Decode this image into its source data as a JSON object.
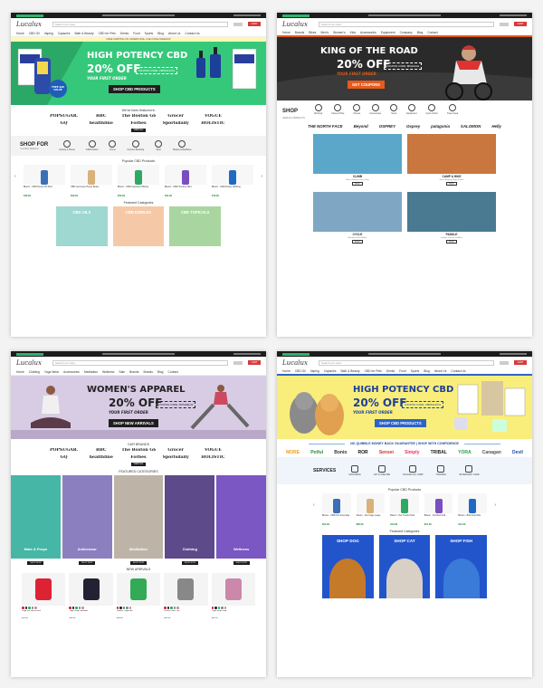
{
  "header": {
    "logo": "Lucalux",
    "search_placeholder": "Search our store",
    "cart_label": "CART",
    "promo": "FREE SHIPPING ON ORDERS $49+ USE CODE FREESHIP"
  },
  "s1": {
    "nav": [
      "Home",
      "CBD Oil",
      "Vaping",
      "Capsules",
      "Bath & Beauty",
      "CBD for Pets",
      "Drinks",
      "Food",
      "Sports",
      "Blog",
      "About Us",
      "Contact Us"
    ],
    "hero_title": "HIGH POTENCY CBD",
    "hero_off": "20% OFF",
    "hero_sub": "YOUR FIRST ORDER",
    "coupon": "COUPON CODE: CBDSCHOOL",
    "cta": "SHOP CBD PRODUCTS",
    "badge": "FREE $60 VALUE",
    "featured_title": "We've been featured in",
    "brands": [
      "POPSUGAR.",
      "BBC",
      "The Boston Globe",
      "Grocer",
      "VOGUE",
      "GQ",
      "healthline",
      "Forbes",
      "Sportsdaily",
      "HOLISTIC"
    ],
    "view_all": "VIEW ALL",
    "shop_for": "SHOP FOR",
    "shop_for_sub": "Your Best Wellness",
    "icons": [
      {
        "icon": "sleep-icon",
        "label": "Anxiety & Stress"
      },
      {
        "icon": "pain-icon",
        "label": "Inflammation"
      },
      {
        "icon": "focus-icon",
        "label": "Focus"
      },
      {
        "icon": "muscle-icon",
        "label": "Immune Boosting"
      },
      {
        "icon": "sport-icon",
        "label": "Sport"
      },
      {
        "icon": "beauty-icon",
        "label": "Beauty & Radiance"
      }
    ],
    "popular_title": "Popular CBD Products",
    "products": [
      {
        "title": "Bloom - CBD Hemp Oil 30ml",
        "price": "$49.99"
      },
      {
        "title": "CBD Gummies Hemp Bears",
        "price": "$29.99"
      },
      {
        "title": "Bloom - CBD Capsules 500mg",
        "price": "$59.99"
      },
      {
        "title": "Bloom - CBD Tincture Mint",
        "price": "$44.99"
      },
      {
        "title": "Bloom - CBD Drops 1000mg",
        "price": "$79.99"
      }
    ],
    "featured_categories": "Featured Categories",
    "cats": [
      {
        "name": "CBD OILS",
        "color": "#9fd7d1"
      },
      {
        "name": "CBD EDIBLES",
        "color": "#f5c9a8"
      },
      {
        "name": "CBD TOPICALS",
        "color": "#a9d6a0"
      }
    ]
  },
  "s2": {
    "nav": [
      "Home",
      "Brands",
      "Bikes",
      "Men's",
      "Women's",
      "Kids",
      "Accessories",
      "Equipment",
      "Company",
      "Blog",
      "Contact"
    ],
    "hero_title": "KING OF THE ROAD",
    "hero_off": "20% OFF",
    "hero_sub": "YOUR FIRST ORDER",
    "coupon": "COUPON CODE: BIKESALE",
    "cta": "GET COUPONS",
    "shop": "SHOP",
    "shop_sub": "VIEW ALL PRODUCTS",
    "icons": [
      {
        "icon": "climbing-icon",
        "label": "Climbing"
      },
      {
        "icon": "camp-icon",
        "label": "Camp & Hike"
      },
      {
        "icon": "fitness-icon",
        "label": "Fitness"
      },
      {
        "icon": "accessories-icon",
        "label": "Accessories"
      },
      {
        "icon": "snow-icon",
        "label": "Snow"
      },
      {
        "icon": "equipment-icon",
        "label": "Equipment"
      },
      {
        "icon": "cycle-icon",
        "label": "Cycle & Run"
      },
      {
        "icon": "bags-icon",
        "label": "Travel Gear"
      }
    ],
    "brands": [
      "THE NORTH FACE",
      "Beyond",
      "OSPREY",
      "Osprey",
      "patagonia",
      "SALOMON",
      "Helly"
    ],
    "tiles": [
      {
        "name": "CLIMB",
        "desc": "Rock Climbing Gear Shop",
        "color": "#5aa7c9"
      },
      {
        "name": "CAMP & HIKE",
        "desc": "Tents Sleeping Bags Stoves",
        "color": "#c9773e"
      },
      {
        "name": "CYCLE",
        "desc": "Mountain Road Bikes",
        "color": "#7fa7c4"
      },
      {
        "name": "PADDLE",
        "desc": "Kayaks Canoes Paddles",
        "color": "#4a7a92"
      }
    ],
    "shop_now": "SHOP NOW"
  },
  "s3": {
    "nav": [
      "Home",
      "Clothing",
      "Yoga Wear",
      "Accessories",
      "Meditation",
      "Wellness",
      "Sale",
      "Brands",
      "Brands",
      "Blog",
      "Contact"
    ],
    "hero_title": "WOMEN'S APPAREL",
    "hero_off": "20% OFF",
    "hero_sub": "YOUR FIRST ORDER",
    "coupon": "COUPON CODE: APPAREL20",
    "cta": "SHOP NEW ARRIVALS",
    "brands_title": "OUR BRANDS",
    "brands": [
      "POPSUGAR.",
      "BBC",
      "The Boston Globe",
      "Grocer",
      "VOGUE",
      "GQ",
      "healthline",
      "Forbes",
      "Sportsdaily",
      "HOLISTIC"
    ],
    "view_all": "VIEW ALL",
    "featured_title": "FEATURED CATEGORIES",
    "cats": [
      {
        "name": "Mats & Props",
        "color": "#46b6a6"
      },
      {
        "name": "Activewear",
        "color": "#8c7fbf"
      },
      {
        "name": "Meditation",
        "color": "#bdb4a7"
      },
      {
        "name": "Clothing",
        "color": "#5c4a8a"
      },
      {
        "name": "Wellness",
        "color": "#7a57c2"
      }
    ],
    "shop_now": "SHOP NOW",
    "new_title": "NEW ARRIVALS",
    "items": [
      {
        "title": "Yoga Set Sports Bra",
        "price": "$55.00"
      },
      {
        "title": "Yoga Strap Sandals",
        "price": "$39.00"
      },
      {
        "title": "Classic Yoga Mat",
        "price": "$69.00"
      },
      {
        "title": "Perfect Tank Top",
        "price": "$45.00"
      },
      {
        "title": "Yoga Strap Loop",
        "price": "$19.00"
      }
    ]
  },
  "s4": {
    "nav": [
      "Home",
      "CBD Oil",
      "Vaping",
      "Capsules",
      "Bath & Beauty",
      "CBD for Pets",
      "Drinks",
      "Food",
      "Sports",
      "Blog",
      "About Us",
      "Contact Us"
    ],
    "hero_title": "HIGH POTENCY CBD",
    "hero_off": "20% OFF",
    "hero_sub": "YOUR FIRST ORDER",
    "coupon": "COUPON CODE: CBDSCHOOL",
    "cta": "SHOP CBD PRODUCTS",
    "guarantee": "NO QUIBBLE MONEY BACK GUARANTEE | SHOP WITH CONFIDENCE",
    "brands": [
      "MORE",
      "Petful",
      "Bonio",
      "ROR",
      "Sensei",
      "Simply",
      "TRIBAL",
      "YORA",
      "Canagan",
      "Devil"
    ],
    "services": "SERVICES",
    "service_icons": [
      {
        "icon": "grooming-icon",
        "label": "GROOMING"
      },
      {
        "icon": "vet-icon",
        "label": "VET & SHELTER"
      },
      {
        "icon": "daycare-icon",
        "label": "DOGGIE DAY CAMP"
      },
      {
        "icon": "training-icon",
        "label": "TRAINING"
      },
      {
        "icon": "veterinary-icon",
        "label": "VETERINARY CARE"
      }
    ],
    "popular_title": "Popular CBD Products",
    "products": [
      {
        "title": "Bloom - CBD Pet Food 2kg",
        "price": "$34.99"
      },
      {
        "title": "Bloom - Pet Cage Large",
        "price": "$89.99"
      },
      {
        "title": "Bloom - Pet Treats Pack",
        "price": "$19.99"
      },
      {
        "title": "Bloom - Pet Bed Soft",
        "price": "$54.99"
      },
      {
        "title": "Bloom - Bird Food Mix",
        "price": "$12.99"
      }
    ],
    "featured_title": "Featured Categories",
    "cats": [
      {
        "name": "SHOP DOG"
      },
      {
        "name": "SHOP CAT"
      },
      {
        "name": "SHOP FISH"
      }
    ]
  }
}
